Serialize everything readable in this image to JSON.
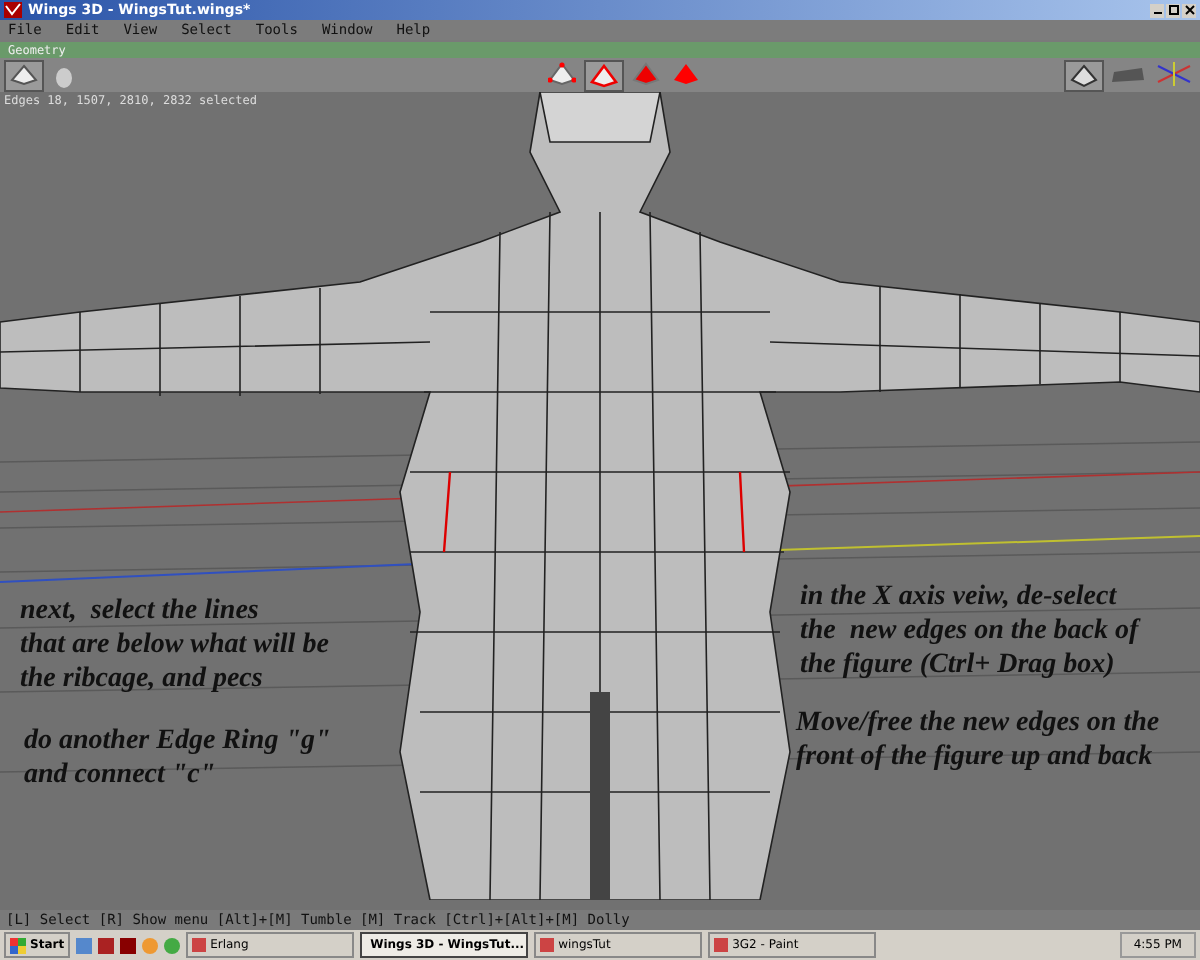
{
  "window": {
    "title": "Wings 3D - WingsTut.wings*"
  },
  "menu": [
    "File",
    "Edit",
    "View",
    "Select",
    "Tools",
    "Window",
    "Help"
  ],
  "geometry_bar": {
    "title": "Geometry"
  },
  "selection_modes": [
    {
      "kind": "vertex",
      "selected": false
    },
    {
      "kind": "edge",
      "selected": true
    },
    {
      "kind": "face",
      "selected": false
    },
    {
      "kind": "body",
      "selected": false
    }
  ],
  "info_line": "Edges 18, 1507, 2810, 2832 selected",
  "annotations": [
    {
      "text": "next,  select the lines\nthat are below what will be\nthe ribcage, and pecs"
    },
    {
      "text": "do another Edge Ring \"g\"\nand connect \"c\""
    },
    {
      "text": "in the X axis veiw, de-select\nthe  new edges on the back of\nthe figure (Ctrl+ Drag box)"
    },
    {
      "text": "Move/free the new edges on the\nfront of the figure up and back"
    }
  ],
  "status_bar": "[L] Select  [R] Show menu  [Alt]+[M] Tumble  [M] Track  [Ctrl]+[Alt]+[M] Dolly",
  "taskbar": {
    "start": "Start",
    "tasks": [
      {
        "label": "Erlang",
        "selected": false
      },
      {
        "label": "Wings 3D - WingsTut...",
        "selected": true
      },
      {
        "label": "wingsTut",
        "selected": false
      },
      {
        "label": "3G2 - Paint",
        "selected": false
      }
    ],
    "clock": "4:55 PM"
  }
}
